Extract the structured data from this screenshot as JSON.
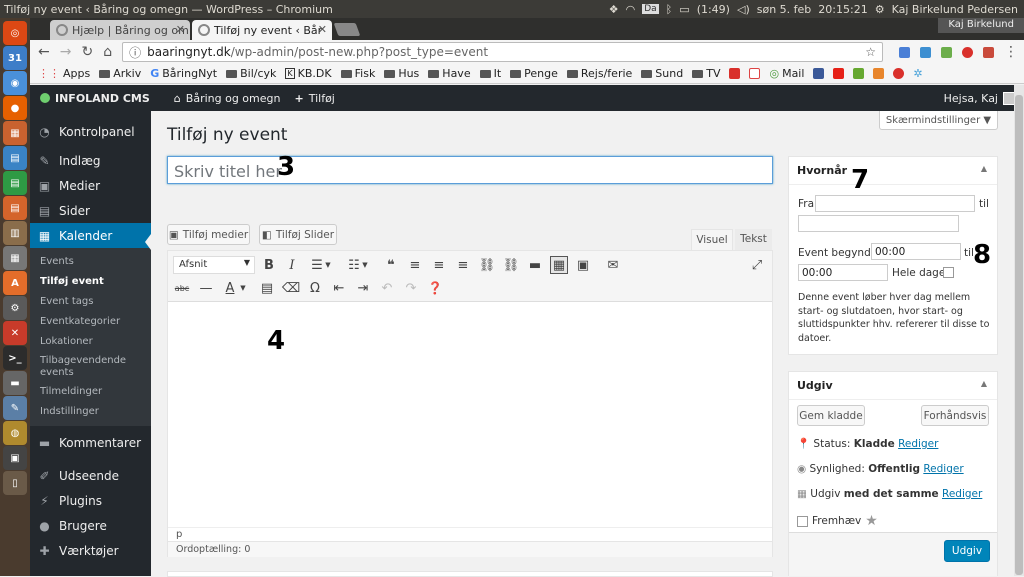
{
  "system": {
    "window_title": "Tilføj ny event ‹ Båring og omegn — WordPress – Chromium",
    "battery": "(1:49)",
    "date": "søn  5. feb",
    "time": "20:15:21",
    "user": "Kaj Birkelund Pedersen",
    "da_badge": "Da"
  },
  "browser": {
    "tabs": [
      {
        "label": "Hjælp | Båring og om"
      },
      {
        "label": "Tilføj ny event ‹ Bår"
      }
    ],
    "user_badge": "Kaj Birkelund",
    "url_host": "baaringnyt.dk",
    "url_path": "/wp-admin/post-new.php?post_type=event",
    "bookmarks": [
      {
        "label": "Apps",
        "icon": "apps-grid-icon"
      },
      {
        "label": "Arkiv",
        "icon": "folder-icon"
      },
      {
        "label": "BåringNyt",
        "icon": "google-icon"
      },
      {
        "label": "Bil/cyk",
        "icon": "folder-icon"
      },
      {
        "label": "KB.DK",
        "icon": "kb-icon"
      },
      {
        "label": "Fisk",
        "icon": "folder-icon"
      },
      {
        "label": "Hus",
        "icon": "folder-icon"
      },
      {
        "label": "Have",
        "icon": "folder-icon"
      },
      {
        "label": "It",
        "icon": "folder-icon"
      },
      {
        "label": "Penge",
        "icon": "folder-icon"
      },
      {
        "label": "Rejs/ferie",
        "icon": "folder-icon"
      },
      {
        "label": "Sund",
        "icon": "folder-icon"
      },
      {
        "label": "TV",
        "icon": "folder-icon"
      },
      {
        "label": "Mail",
        "icon": "mail-ring-icon"
      }
    ]
  },
  "adminbar": {
    "site": "INFOLAND CMS",
    "home": "Båring og omegn",
    "new": "Tilføj",
    "greeting": "Hejsa, Kaj"
  },
  "menu": {
    "items_top": [
      {
        "label": "Kontrolpanel",
        "icon": "dashboard-icon"
      },
      {
        "label": "Indlæg",
        "icon": "pin-icon"
      },
      {
        "label": "Medier",
        "icon": "media-icon"
      },
      {
        "label": "Sider",
        "icon": "pages-icon"
      },
      {
        "label": "Kalender",
        "icon": "calendar-icon"
      }
    ],
    "sub": [
      "Events",
      "Tilføj event",
      "Event tags",
      "Eventkategorier",
      "Lokationer",
      "Tilbagevendende events",
      "Tilmeldinger",
      "Indstillinger"
    ],
    "items_bottom": [
      {
        "label": "Kommentarer",
        "icon": "comments-icon"
      },
      {
        "label": "Udseende",
        "icon": "brush-icon"
      },
      {
        "label": "Plugins",
        "icon": "plugin-icon"
      },
      {
        "label": "Brugere",
        "icon": "users-icon"
      },
      {
        "label": "Værktøjer",
        "icon": "wrench-icon"
      }
    ]
  },
  "page": {
    "heading": "Tilføj ny event",
    "screen_options": "Skærmindstillinger ▼",
    "title_placeholder": "Skriv titel her",
    "add_media": "Tilføj medier",
    "add_slider": "Tilføj Slider",
    "tab_visual": "Visuel",
    "tab_text": "Tekst",
    "format_select": "Afsnit",
    "path": "p",
    "word_count": "Ordoptælling: 0"
  },
  "annotations": {
    "n3": "3",
    "n4": "4",
    "n7": "7",
    "n8": "8"
  },
  "when_box": {
    "title": "Hvornår",
    "from": "Fra",
    "to": "til",
    "begins": "Event begynder",
    "start_time": "00:00",
    "to2": "til",
    "end_time": "00:00",
    "all_day": "Hele dagen",
    "desc": "Denne event løber hver dag mellem start- og slutdatoen, hvor start- og sluttidspunkter hhv. refererer til disse to datoer."
  },
  "publish_box": {
    "title": "Udgiv",
    "save_draft": "Gem kladde",
    "preview": "Forhåndsvis",
    "status_label": "Status:",
    "status_value": "Kladde",
    "visibility_label": "Synlighed:",
    "visibility_value": "Offentlig",
    "publish_label": "Udgiv",
    "publish_value": "med det samme",
    "edit": "Rediger",
    "featured": "Fremhæv",
    "publish_button": "Udgiv"
  },
  "colors": {
    "wp_blue": "#0073aa",
    "admin_dark": "#23282d",
    "ubuntu_bar": "#3c3b37"
  }
}
